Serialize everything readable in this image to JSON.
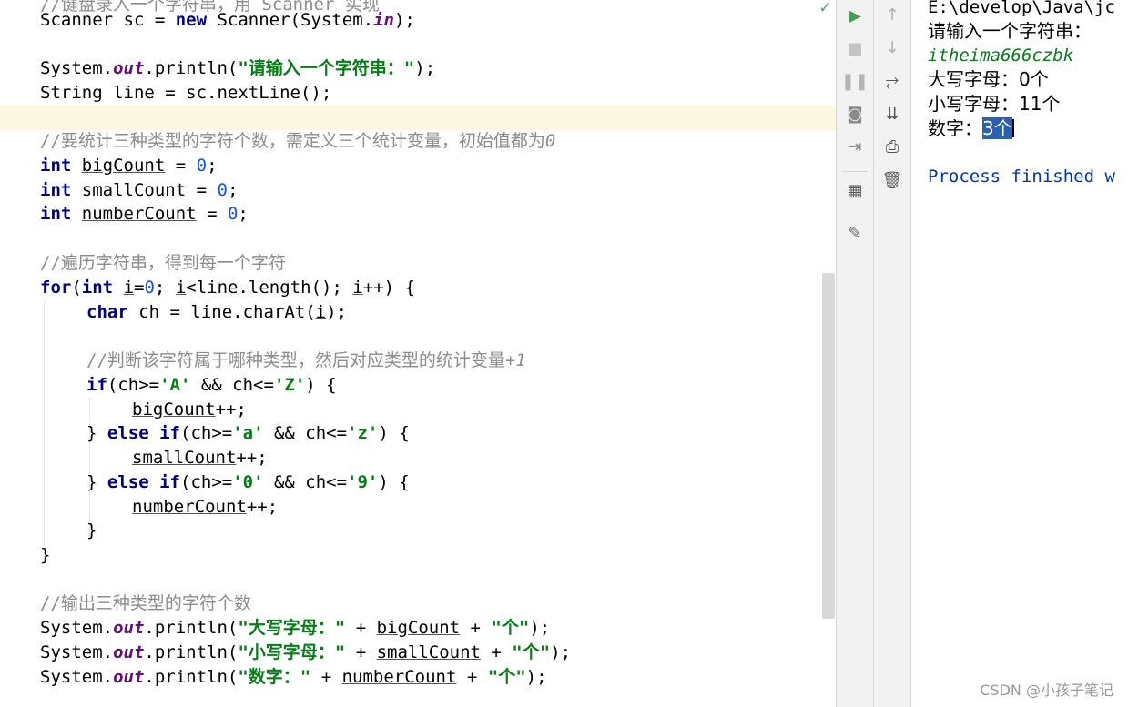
{
  "editor": {
    "lines": {
      "l0": "//键盘录入一个字符串，用 Scanner 实现",
      "l1a": "Scanner sc = ",
      "l1kw": "new",
      "l1b": " Scanner(System.",
      "l1f": "in",
      "l1c": ");",
      "l3a": "System.",
      "l3f": "out",
      "l3b": ".println(",
      "l3s": "\"请输入一个字符串：\"",
      "l3c": ");",
      "l4": "String line = sc.nextLine();",
      "l6": "//要统计三种类型的字符个数，需定义三个统计变量，初始值都为",
      "l6n": "0",
      "int": "int",
      "big": "bigCount",
      "small": "smallCount",
      "numc": "numberCount",
      "eq0": " = ",
      "zero": "0",
      "semi": ";",
      "l11": "//遍历字符串，得到每一个字符",
      "for": "for",
      "paren": "(",
      "i": "i",
      "l12a": "=",
      "l12b": "; ",
      "l12c": "<line.length(); ",
      "l12d": "++) {",
      "char": "char",
      "l13a": " ch = line.charAt(",
      "l13b": ");",
      "l15": "//判断该字符属于哪种类型，然后对应类型的统计变量",
      "l15n": "+1",
      "if": "if",
      "else": "else",
      "l16a": "(ch>=",
      "cA": "'A'",
      "l16b": " && ch<=",
      "cZ": "'Z'",
      "l16c": ") {",
      "incr": "++;",
      "close_else": "} ",
      "sp": " ",
      "ca": "'a'",
      "cz": "'z'",
      "c0": "'0'",
      "c9": "'9'",
      "rb": "}",
      "l25": "//输出三种类型的字符个数",
      "p1": "\"大写字母：\"",
      "p2": "\"小写字母：\"",
      "p3": "\"数字：\"",
      "plus": " + ",
      "ge": "\"个\"",
      "end": ");"
    }
  },
  "run_toolbar": {
    "icons": [
      "run-icon",
      "stop-icon",
      "pause-icon",
      "camera-icon",
      "login-icon",
      "layout-icon",
      "pin-icon"
    ]
  },
  "side_toolbar": {
    "icons": [
      "arrow-up-icon",
      "arrow-down-icon",
      "soft-wrap-icon",
      "scroll-to-end-icon",
      "print-icon",
      "trash-icon"
    ]
  },
  "console": {
    "path": "E:\\develop\\Java\\jc",
    "prompt": "请输入一个字符串：",
    "input": "itheima666czbk",
    "upper": "大写字母：0个",
    "lower": "小写字母：11个",
    "digit_label": "数字：",
    "digit_value": "3个",
    "process": "Process finished w"
  },
  "watermark": "CSDN @小孩子笔记",
  "colors": {
    "keyword": "#000080",
    "string": "#067d17",
    "field": "#660e7a",
    "number": "#1750eb",
    "comment": "#8c8c8c",
    "selection": "#2b5fb4"
  }
}
